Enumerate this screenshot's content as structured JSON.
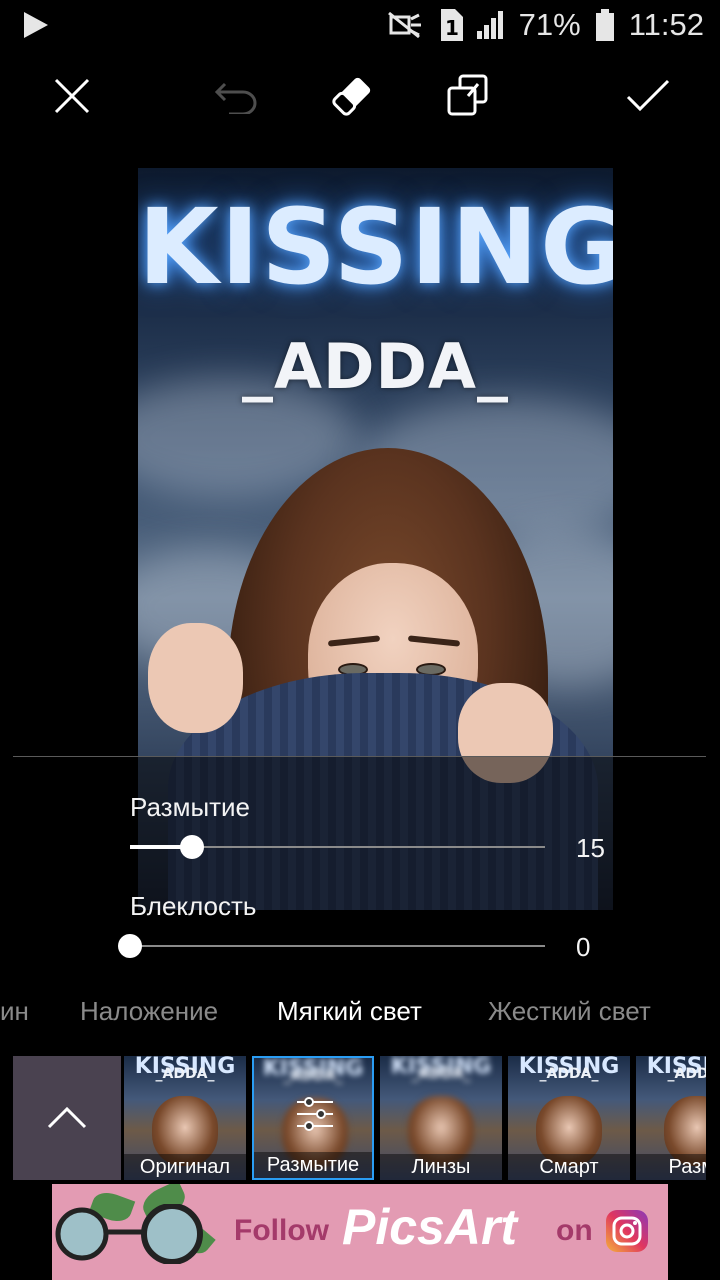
{
  "status_bar": {
    "battery": "71%",
    "time": "11:52",
    "sim_badge": "1",
    "icons": [
      "play-icon",
      "mute-icon",
      "sim-icon",
      "signal-icon",
      "battery-icon"
    ]
  },
  "toolbar": {
    "buttons": [
      "close-icon",
      "undo-icon",
      "eraser-icon",
      "compare-icon",
      "apply-check-icon"
    ]
  },
  "photo": {
    "title": "KISSING",
    "subtitle": "_ADDA_"
  },
  "sliders": [
    {
      "label": "Размытие",
      "value": "15",
      "level": 0.15
    },
    {
      "label": "Блеклость",
      "value": "0",
      "level": 0
    }
  ],
  "blend_modes": [
    "ин",
    "Наложение",
    "Мягкий свет",
    "Жесткий свет"
  ],
  "active_blend_mode": "Мягкий свет",
  "effects": [
    {
      "label": "Оригинал"
    },
    {
      "label": "Размытие",
      "selected": true
    },
    {
      "label": "Линзы"
    },
    {
      "label": "Смарт"
    },
    {
      "label": "Размь"
    }
  ],
  "ad": {
    "follow": "Follow",
    "brand": "PicsArt",
    "on": "on"
  },
  "colors": {
    "accent": "#2a9df4",
    "ad_background": "#e39bb3"
  }
}
